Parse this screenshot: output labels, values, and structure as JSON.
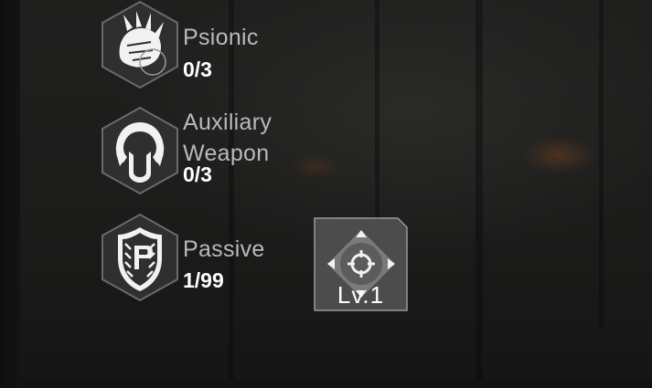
{
  "skills": [
    {
      "name": "Psionic",
      "count": "0/3",
      "icon": "claw-icon"
    },
    {
      "name": "Auxiliary Weapon",
      "name_line1": "Auxiliary",
      "name_line2": "Weapon",
      "count": "0/3",
      "icon": "auxiliary-weapon-icon"
    },
    {
      "name": "Passive",
      "count": "1/99",
      "icon": "passive-shield-icon"
    }
  ],
  "passive_slot": {
    "level": "Lv.1",
    "icon": "crosshair-arrows-icon"
  },
  "colors": {
    "hex_fill": "#2f2f2f",
    "hex_border": "#6a6a6a",
    "label": "#b9b9b9",
    "count": "#ffffff",
    "tile_fill": "#4c4c4c"
  }
}
